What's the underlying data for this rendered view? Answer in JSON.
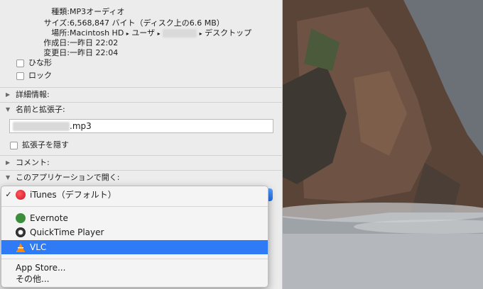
{
  "info": {
    "kind_label": "種類:",
    "kind_value": "MP3オーディオ",
    "size_label": "サイズ:",
    "size_value": "6,568,847 バイト（ディスク上の6.6 MB）",
    "location_label": "場所:",
    "location_parts": [
      "Macintosh HD",
      "ユーザ",
      "デスクトップ"
    ],
    "created_label": "作成日:",
    "created_value": "一昨日 22:02",
    "modified_label": "変更日:",
    "modified_value": "一昨日 22:04"
  },
  "checkboxes": {
    "stationery": "ひな形",
    "locked": "ロック",
    "hide_extension": "拡張子を隠す"
  },
  "sections": {
    "more_info": "詳細情報:",
    "name_ext": "名前と拡張子:",
    "comments": "コメント:",
    "open_with": "このアプリケーションで開く:"
  },
  "filename": {
    "extension": ".mp3"
  },
  "open_with_menu": {
    "default_app": "iTunes（デフォルト）",
    "apps": [
      "Evernote",
      "QuickTime Player",
      "VLC"
    ],
    "selected_app": "VLC",
    "footer": [
      "App Store...",
      "その他..."
    ]
  }
}
